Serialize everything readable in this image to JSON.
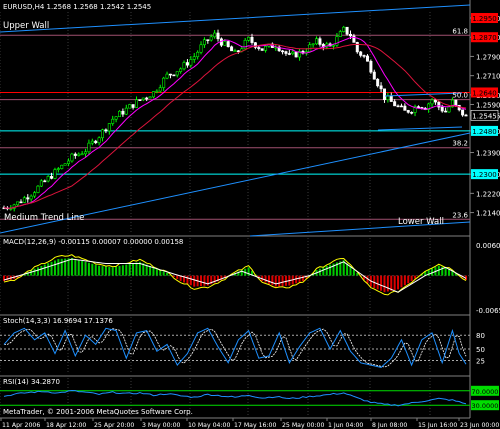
{
  "window": {
    "header": "EURUSD,H4  1.2568 1.2568 1.2542 1.2545",
    "copyright": "MetaTrader, © 2001-2006 MetaQuotes Software Corp."
  },
  "colors": {
    "background": "#000000",
    "grid": "#3a3a3a",
    "bull_candle": "#00ff00",
    "bear_candle": "#ffffff",
    "trend_line": "#1e90ff",
    "fib_line": "#a05070",
    "ma_fast": "#ff00ff",
    "ma_slow": "#dc143c",
    "macd_hist_up": "#00cc00",
    "macd_hist_down": "#dd0000",
    "macd_line": "#ffff00",
    "macd_signal": "#ffffff",
    "stoch_main": "#1e90ff",
    "stoch_signal": "#ffffff",
    "rsi_line": "#1e90ff",
    "rsi_levels": "#00dd00",
    "price_tag_red": "#ff0000",
    "price_tag_cyan": "#00ffff"
  },
  "chart_data": [
    {
      "type": "candlestick",
      "symbol": "EURUSD",
      "timeframe": "H4",
      "header": {
        "open": 1.2568,
        "high": 1.2568,
        "low": 1.2542,
        "close": 1.2545
      },
      "ylim": [
        1.2055,
        1.2975
      ],
      "y_ticks": [
        "1.2950",
        "1.2870",
        "1.2790",
        "1.2710",
        "1.2630",
        "1.2590",
        "1.2545",
        "1.2480",
        "1.2390",
        "1.2300",
        "1.2220",
        "1.2140"
      ],
      "x_ticks": [
        "11 Apr 2006",
        "18 Apr 12:00",
        "25 Apr 20:00",
        "3 May 00:00",
        "10 May 04:00",
        "17 May 16:00",
        "25 May 00:00",
        "1 Jun 04:00",
        "8 Jun 08:00",
        "15 Jun 16:00",
        "23 Jun 00:00"
      ],
      "close_path": [
        [
          0,
          1.216
        ],
        [
          4,
          1.218
        ],
        [
          8,
          1.222
        ],
        [
          12,
          1.227
        ],
        [
          16,
          1.232
        ],
        [
          20,
          1.237
        ],
        [
          24,
          1.24
        ],
        [
          28,
          1.246
        ],
        [
          32,
          1.253
        ],
        [
          36,
          1.257
        ],
        [
          40,
          1.261
        ],
        [
          44,
          1.264
        ],
        [
          48,
          1.271
        ],
        [
          52,
          1.274
        ],
        [
          56,
          1.279
        ],
        [
          58,
          1.283
        ],
        [
          60,
          1.286
        ],
        [
          62,
          1.288
        ],
        [
          64,
          1.285
        ],
        [
          68,
          1.28
        ],
        [
          72,
          1.286
        ],
        [
          76,
          1.282
        ],
        [
          80,
          1.284
        ],
        [
          84,
          1.279
        ],
        [
          88,
          1.281
        ],
        [
          92,
          1.285
        ],
        [
          96,
          1.283
        ],
        [
          100,
          1.29
        ],
        [
          102,
          1.288
        ],
        [
          104,
          1.281
        ],
        [
          106,
          1.279
        ],
        [
          108,
          1.274
        ],
        [
          110,
          1.268
        ],
        [
          112,
          1.262
        ],
        [
          114,
          1.26
        ],
        [
          116,
          1.258
        ],
        [
          118,
          1.256
        ],
        [
          120,
          1.257
        ],
        [
          122,
          1.259
        ],
        [
          124,
          1.258
        ],
        [
          126,
          1.261
        ],
        [
          128,
          1.258
        ],
        [
          130,
          1.256
        ],
        [
          132,
          1.26
        ],
        [
          134,
          1.256
        ],
        [
          136,
          1.2545
        ]
      ],
      "price_labels": [
        {
          "text": "1.2950",
          "price": 1.295,
          "style": "red"
        },
        {
          "text": "1.2870",
          "price": 1.287,
          "style": "red"
        },
        {
          "text": "1.2640",
          "price": 1.264,
          "style": "red"
        },
        {
          "text": "1.2545",
          "price": 1.2545,
          "style": "plain"
        },
        {
          "text": "1.2480",
          "price": 1.248,
          "style": "cyan"
        },
        {
          "text": "1.2300",
          "price": 1.23,
          "style": "cyan"
        }
      ],
      "fibonacci_levels": [
        {
          "label": "61.8",
          "price": 1.2878
        },
        {
          "label": "50.0",
          "price": 1.261
        },
        {
          "label": "38.2",
          "price": 1.241
        },
        {
          "label": "23.6",
          "price": 1.2112
        }
      ],
      "horizontal_levels": [
        {
          "price": 1.264,
          "color": "red"
        },
        {
          "price": 1.248,
          "color": "cyan"
        },
        {
          "price": 1.23,
          "color": "cyan"
        }
      ],
      "annotations": [
        "Upper Wall",
        "Medium Trend Line",
        "Lower Wall"
      ]
    },
    {
      "type": "histogram+line",
      "name": "MACD",
      "label": "MACD(12,26,9) -0.00115 0.00007 0.00000 0.00158",
      "y_ticks": [
        "0.00609",
        "-0.00659"
      ],
      "ylim": [
        -0.0066,
        0.0061
      ],
      "histogram": [
        [
          0,
          -0.001
        ],
        [
          4,
          -0.0005
        ],
        [
          8,
          0.001
        ],
        [
          12,
          0.002
        ],
        [
          16,
          0.003
        ],
        [
          20,
          0.0032
        ],
        [
          24,
          0.0025
        ],
        [
          28,
          0.0018
        ],
        [
          32,
          0.0015
        ],
        [
          36,
          0.002
        ],
        [
          40,
          0.0025
        ],
        [
          44,
          0.0015
        ],
        [
          48,
          0.0005
        ],
        [
          52,
          -0.001
        ],
        [
          56,
          -0.002
        ],
        [
          60,
          -0.0018
        ],
        [
          64,
          -0.0008
        ],
        [
          68,
          0.0005
        ],
        [
          72,
          0.0015
        ],
        [
          76,
          -0.001
        ],
        [
          80,
          -0.002
        ],
        [
          84,
          -0.0018
        ],
        [
          88,
          -0.001
        ],
        [
          92,
          0.001
        ],
        [
          96,
          0.002
        ],
        [
          100,
          0.0028
        ],
        [
          104,
          0.0005
        ],
        [
          108,
          -0.002
        ],
        [
          112,
          -0.003
        ],
        [
          116,
          -0.0025
        ],
        [
          120,
          -0.001
        ],
        [
          124,
          0.0008
        ],
        [
          128,
          0.0018
        ],
        [
          132,
          0.001
        ],
        [
          136,
          -0.0008
        ]
      ],
      "signal_line": [
        [
          0,
          -0.0008
        ],
        [
          10,
          0.001
        ],
        [
          20,
          0.003
        ],
        [
          30,
          0.0022
        ],
        [
          40,
          0.0022
        ],
        [
          50,
          0.0003
        ],
        [
          60,
          -0.0015
        ],
        [
          70,
          0.0008
        ],
        [
          80,
          -0.0015
        ],
        [
          90,
          0.0
        ],
        [
          100,
          0.0025
        ],
        [
          108,
          -0.001
        ],
        [
          116,
          -0.003
        ],
        [
          124,
          0.0
        ],
        [
          130,
          0.0015
        ],
        [
          136,
          -0.0005
        ]
      ]
    },
    {
      "type": "line",
      "name": "Stochastic",
      "label": "Stoch(14,3,3) 16.9694 17.1376",
      "levels": [
        "80",
        "50",
        "25"
      ],
      "ylim": [
        0,
        100
      ],
      "series": [
        {
          "name": "main",
          "values": [
            [
              0,
              60
            ],
            [
              3,
              85
            ],
            [
              6,
              95
            ],
            [
              9,
              70
            ],
            [
              12,
              85
            ],
            [
              15,
              40
            ],
            [
              18,
              90
            ],
            [
              21,
              35
            ],
            [
              24,
              80
            ],
            [
              27,
              60
            ],
            [
              30,
              95
            ],
            [
              33,
              90
            ],
            [
              36,
              30
            ],
            [
              39,
              85
            ],
            [
              42,
              90
            ],
            [
              45,
              45
            ],
            [
              48,
              60
            ],
            [
              51,
              15
            ],
            [
              54,
              40
            ],
            [
              57,
              85
            ],
            [
              60,
              95
            ],
            [
              63,
              55
            ],
            [
              66,
              20
            ],
            [
              69,
              70
            ],
            [
              72,
              90
            ],
            [
              75,
              30
            ],
            [
              78,
              35
            ],
            [
              81,
              85
            ],
            [
              84,
              20
            ],
            [
              87,
              55
            ],
            [
              90,
              85
            ],
            [
              93,
              95
            ],
            [
              96,
              50
            ],
            [
              99,
              90
            ],
            [
              102,
              45
            ],
            [
              105,
              20
            ],
            [
              108,
              15
            ],
            [
              111,
              10
            ],
            [
              114,
              30
            ],
            [
              117,
              70
            ],
            [
              120,
              15
            ],
            [
              123,
              70
            ],
            [
              126,
              85
            ],
            [
              129,
              20
            ],
            [
              132,
              90
            ],
            [
              134,
              40
            ],
            [
              136,
              17
            ]
          ]
        }
      ]
    },
    {
      "type": "line",
      "name": "RSI",
      "label": "RSI(14) 34.2870",
      "levels": [
        "70.0000",
        "30.0000"
      ],
      "ylim": [
        0,
        100
      ],
      "series": [
        {
          "name": "rsi",
          "values": [
            [
              0,
              55
            ],
            [
              4,
              62
            ],
            [
              8,
              66
            ],
            [
              12,
              68
            ],
            [
              16,
              64
            ],
            [
              20,
              70
            ],
            [
              24,
              66
            ],
            [
              28,
              60
            ],
            [
              32,
              66
            ],
            [
              36,
              62
            ],
            [
              40,
              64
            ],
            [
              44,
              58
            ],
            [
              48,
              62
            ],
            [
              52,
              56
            ],
            [
              56,
              52
            ],
            [
              60,
              60
            ],
            [
              64,
              56
            ],
            [
              68,
              52
            ],
            [
              72,
              58
            ],
            [
              76,
              50
            ],
            [
              80,
              54
            ],
            [
              84,
              48
            ],
            [
              88,
              52
            ],
            [
              92,
              56
            ],
            [
              96,
              60
            ],
            [
              100,
              64
            ],
            [
              104,
              50
            ],
            [
              108,
              38
            ],
            [
              112,
              32
            ],
            [
              116,
              30
            ],
            [
              120,
              36
            ],
            [
              124,
              42
            ],
            [
              128,
              48
            ],
            [
              132,
              44
            ],
            [
              136,
              34
            ]
          ]
        }
      ]
    }
  ]
}
